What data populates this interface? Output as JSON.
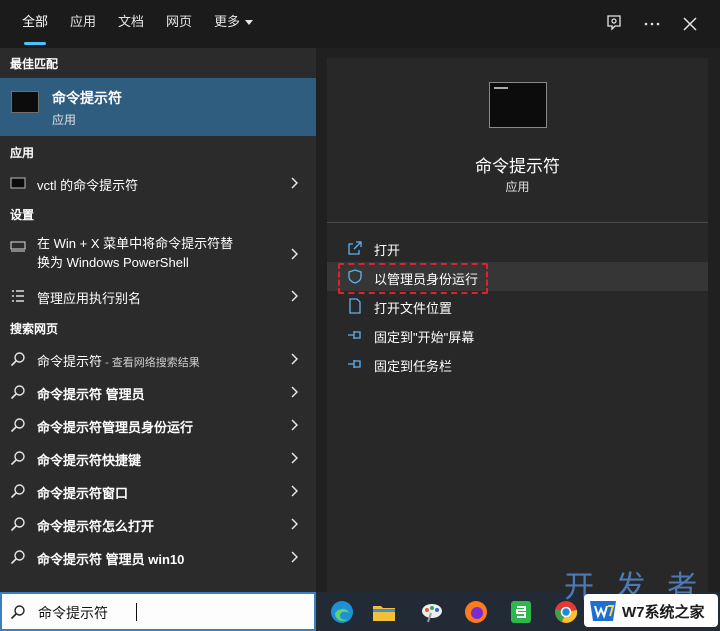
{
  "tabs": [
    {
      "label": "全部",
      "active": true
    },
    {
      "label": "应用",
      "active": false
    },
    {
      "label": "文档",
      "active": false
    },
    {
      "label": "网页",
      "active": false
    },
    {
      "label": "更多",
      "active": false
    }
  ],
  "toolbar_icons": [
    "feedback-icon",
    "more-icon",
    "close-icon"
  ],
  "left": {
    "best_match_heading": "最佳匹配",
    "best_match": {
      "title": "命令提示符",
      "subtitle": "应用"
    },
    "apps_heading": "应用",
    "apps": [
      {
        "label": "vctl 的命令提示符"
      }
    ],
    "settings_heading": "设置",
    "settings": [
      {
        "line1": "在 Win + X 菜单中将命令提示符替",
        "line2": "换为 Windows PowerShell"
      },
      {
        "label": "管理应用执行别名"
      }
    ],
    "web_heading": "搜索网页",
    "web": [
      {
        "label": "命令提示符",
        "hint": " - 查看网络搜索结果"
      },
      {
        "label": "命令提示符 管理员"
      },
      {
        "label": "命令提示符管理员身份运行"
      },
      {
        "label": "命令提示符快捷键"
      },
      {
        "label": "命令提示符窗口"
      },
      {
        "label": "命令提示符怎么打开"
      },
      {
        "label": "命令提示符 管理员 win10"
      }
    ]
  },
  "right": {
    "title": "命令提示符",
    "subtitle": "应用",
    "actions": [
      {
        "label": "打开",
        "icon": "open-icon"
      },
      {
        "label": "以管理员身份运行",
        "icon": "shield-icon"
      },
      {
        "label": "打开文件位置",
        "icon": "file-location-icon"
      },
      {
        "label": "固定到\"开始\"屏幕",
        "icon": "pin-icon"
      },
      {
        "label": "固定到任务栏",
        "icon": "pin-icon"
      }
    ]
  },
  "search": {
    "value": "命令提示符"
  },
  "taskbar": [
    "edge-icon",
    "file-explorer-icon",
    "paint-icon",
    "firefox-icon",
    "sheets-icon",
    "chrome-icon"
  ],
  "watermark": {
    "cn": "开 发 者",
    "badge": "W7系统之家"
  },
  "colors": {
    "accent": "#4cc2ff",
    "selected": "#2f5d80",
    "highlight_border": "#e0202a"
  }
}
